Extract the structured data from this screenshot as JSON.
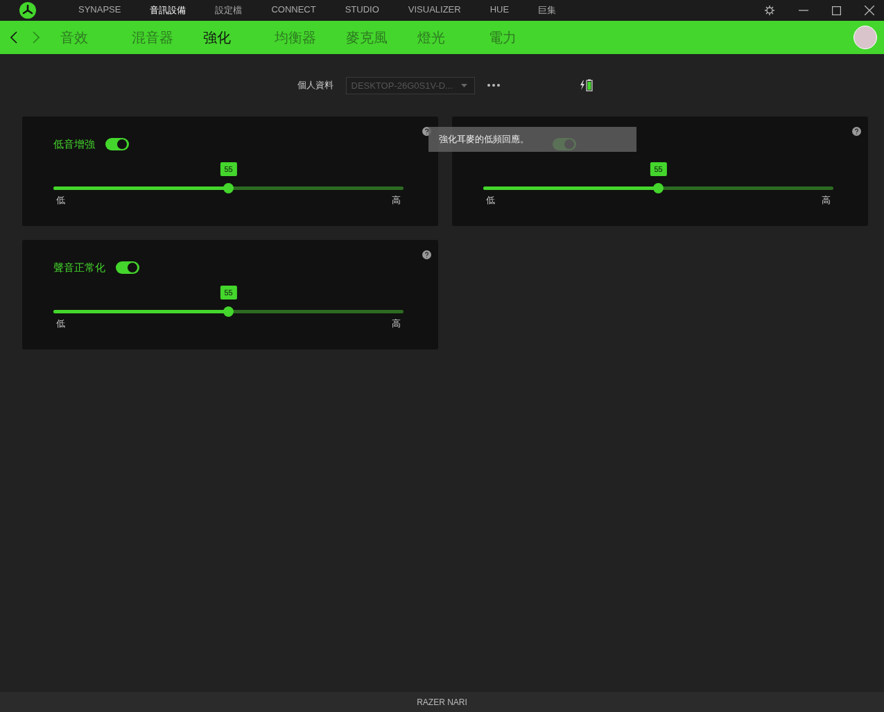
{
  "top_nav": [
    {
      "label": "SYNAPSE",
      "selected": false
    },
    {
      "label": "音訊設備",
      "selected": true
    },
    {
      "label": "設定檔",
      "selected": false
    },
    {
      "label": "CONNECT",
      "selected": false
    },
    {
      "label": "STUDIO",
      "selected": false
    },
    {
      "label": "VISUALIZER",
      "selected": false
    },
    {
      "label": "HUE",
      "selected": false
    },
    {
      "label": "巨集",
      "selected": false
    }
  ],
  "sub_tabs": [
    {
      "label": "音效",
      "selected": false
    },
    {
      "label": "混音器",
      "selected": false
    },
    {
      "label": "強化",
      "selected": true
    },
    {
      "label": "均衡器",
      "selected": false
    },
    {
      "label": "麥克風",
      "selected": false
    },
    {
      "label": "燈光",
      "selected": false
    },
    {
      "label": "電力",
      "selected": false
    }
  ],
  "profile": {
    "label": "個人資料",
    "value": "DESKTOP-26G0S1V-D..."
  },
  "cards": [
    {
      "title": "低音增強",
      "on": true,
      "level": 0.5,
      "value": "55",
      "low": "低",
      "high": "高"
    },
    {
      "on": true,
      "level": 0.5,
      "value": "55",
      "low": "低",
      "high": "高"
    },
    {
      "title": "聲音正常化",
      "on": true,
      "level": 0.5,
      "value": "55",
      "low": "低",
      "high": "高"
    }
  ],
  "tooltip": "強化耳麥的低頻回應。",
  "status_bar": "RAZER NARI"
}
